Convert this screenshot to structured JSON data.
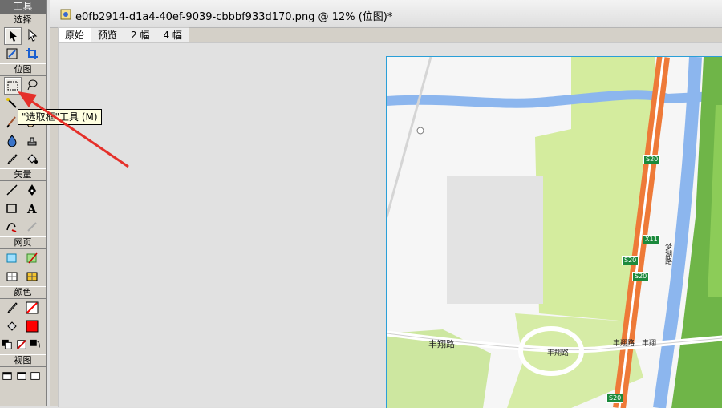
{
  "toolbox": {
    "title": "工具",
    "sections": {
      "select": "选择",
      "bitmap": "位图",
      "vector": "矢量",
      "web": "网页",
      "colors": "颜色",
      "view": "视图"
    }
  },
  "tooltip": "\"选取框\"工具 (M)",
  "document": {
    "title": "e0fb2914-d1a4-40ef-9039-cbbbf933d170.png @   12% (位图)*",
    "tabs": [
      "原始",
      "预览",
      "2 幅",
      "4 幅"
    ]
  },
  "map": {
    "road_labels": [
      "丰翔路",
      "丰翔路",
      "丰翔路",
      "丰翔",
      "梦湖路"
    ],
    "shields": [
      "S20",
      "X11",
      "S20",
      "S20",
      "S20"
    ]
  },
  "colors": {
    "accent_arrow": "#e5302a",
    "fill_color": "#ff0000",
    "stroke_color": "#ff0000"
  }
}
